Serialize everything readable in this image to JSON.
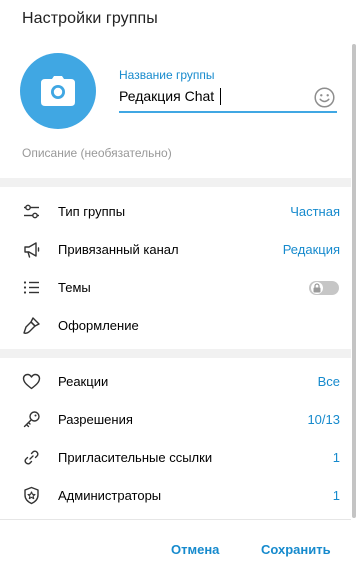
{
  "dialog": {
    "title": "Настройки группы"
  },
  "group": {
    "name_label": "Название группы",
    "name_value": "Редакция Chat",
    "description_placeholder": "Описание (необязательно)"
  },
  "section1": {
    "items": [
      {
        "label": "Тип группы",
        "value": "Частная",
        "icon": "sliders-icon"
      },
      {
        "label": "Привязанный канал",
        "value": "Редакция",
        "icon": "megaphone-icon"
      },
      {
        "label": "Темы",
        "toggle": "off-locked",
        "icon": "list-icon"
      },
      {
        "label": "Оформление",
        "icon": "brush-icon"
      }
    ]
  },
  "section2": {
    "items": [
      {
        "label": "Реакции",
        "value": "Все",
        "icon": "heart-icon"
      },
      {
        "label": "Разрешения",
        "value": "10/13",
        "icon": "key-icon"
      },
      {
        "label": "Пригласительные ссылки",
        "value": "1",
        "icon": "link-icon"
      },
      {
        "label": "Администраторы",
        "value": "1",
        "icon": "shield-star-icon"
      }
    ]
  },
  "buttons": {
    "cancel": "Отмена",
    "save": "Сохранить"
  },
  "colors": {
    "accent": "#40a7e3",
    "link": "#168acd",
    "muted": "#999999"
  }
}
